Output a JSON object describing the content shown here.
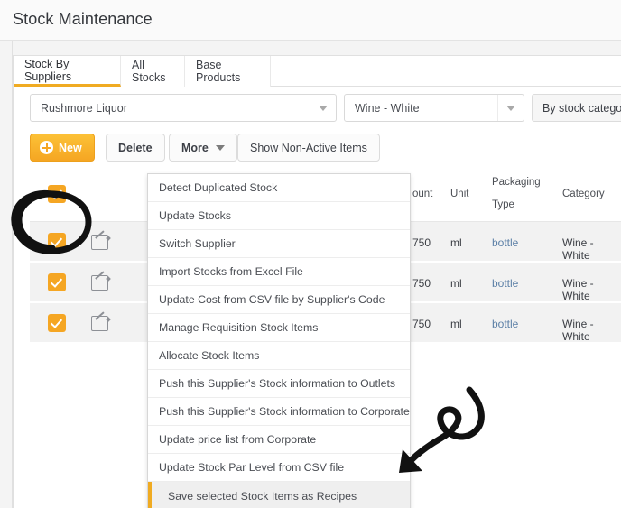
{
  "header": {
    "title": "Stock Maintenance"
  },
  "tabs": [
    {
      "label": "Stock By Suppliers",
      "active": true
    },
    {
      "label": "All Stocks",
      "active": false
    },
    {
      "label": "Base Products",
      "active": false
    }
  ],
  "filters": {
    "supplier_select": {
      "value": "Rushmore Liquor"
    },
    "category_select": {
      "value": "Wine - White"
    },
    "by_stock_category_button": {
      "label": "By stock category"
    }
  },
  "toolbar": {
    "new_label": "New",
    "delete_label": "Delete",
    "more_label": "More",
    "show_non_active_label": "Show Non-Active Items"
  },
  "more_menu": {
    "items": [
      {
        "label": "Detect Duplicated Stock",
        "selected": false
      },
      {
        "label": "Update Stocks",
        "selected": false
      },
      {
        "label": "Switch Supplier",
        "selected": false
      },
      {
        "label": "Import Stocks from Excel File",
        "selected": false
      },
      {
        "label": "Update Cost from CSV file by Supplier's Code",
        "selected": false
      },
      {
        "label": "Manage Requisition Stock Items",
        "selected": false
      },
      {
        "label": "Allocate Stock Items",
        "selected": false
      },
      {
        "label": "Push this Supplier's Stock information to Outlets",
        "selected": false
      },
      {
        "label": "Push this Supplier's Stock information to Corporate",
        "selected": false
      },
      {
        "label": "Update price list from Corporate",
        "selected": false
      },
      {
        "label": "Update Stock Par Level from CSV file",
        "selected": false
      },
      {
        "label": "Save selected Stock Items as Recipes",
        "selected": true
      }
    ]
  },
  "table": {
    "headers": {
      "amount": "ount",
      "unit": "Unit",
      "packaging_type_line1": "Packaging",
      "packaging_type_line2": "Type",
      "category": "Category"
    },
    "header_checkbox_checked": true,
    "rows": [
      {
        "checked": true,
        "amount": "750",
        "unit": "ml",
        "packaging": "bottle",
        "category": "Wine - White"
      },
      {
        "checked": true,
        "amount": "750",
        "unit": "ml",
        "packaging": "bottle",
        "category": "Wine - White"
      },
      {
        "checked": true,
        "amount": "750",
        "unit": "ml",
        "packaging": "bottle",
        "category": "Wine - White"
      }
    ]
  },
  "annotations": {
    "circle_target": "header-select-all-checkbox",
    "arrow_target": "save-selected-stock-items-as-recipes"
  },
  "colors": {
    "accent": "#f5a623",
    "tab_underline": "#f0ab22",
    "link": "#5b7fa6",
    "row_bg": "#f2f2f2",
    "annotation": "#111111"
  }
}
